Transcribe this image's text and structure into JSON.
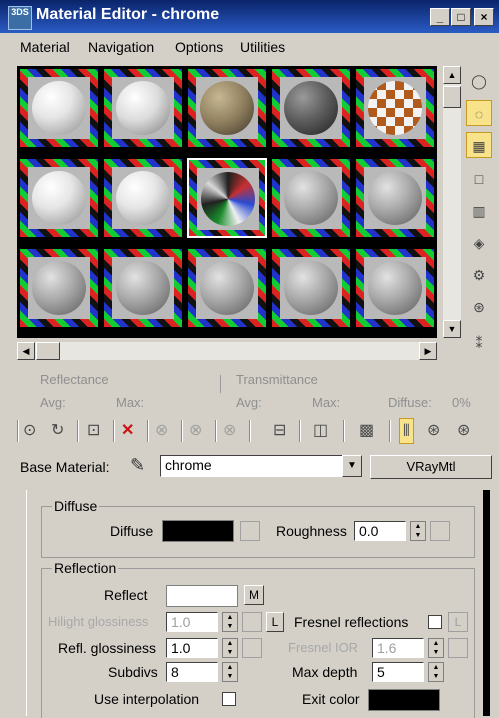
{
  "window": {
    "app_icon_text": "3DS",
    "title": "Material Editor - chrome",
    "min_label": "_",
    "max_label": "□",
    "close_label": "×"
  },
  "menu": [
    "Material",
    "Navigation",
    "Options",
    "Utilities"
  ],
  "slot_types": [
    [
      "white-matte",
      "white-textured",
      "stone",
      "dark-gray",
      "checker"
    ],
    [
      "white-matte",
      "white-matte",
      "chrome-selected",
      "gray",
      "gray"
    ],
    [
      "gray",
      "gray",
      "gray",
      "gray",
      "gray"
    ]
  ],
  "side_tools": [
    "sample-type-sphere-icon",
    "backlight-icon",
    "background-checker-icon",
    "sample-uv-tiling-icon",
    "video-color-check-icon",
    "make-preview-icon",
    "options-icon",
    "select-by-material-icon",
    "material-map-navigator-icon"
  ],
  "status": {
    "reflectance_label": "Reflectance",
    "transmittance_label": "Transmittance",
    "avg_label": "Avg:",
    "max_label": "Max:",
    "diffuse_label": "Diffuse:",
    "diffuse_value": "0%"
  },
  "base_material": {
    "label": "Base Material:",
    "name": "chrome",
    "type_button": "VRayMtl"
  },
  "diffuse_group": {
    "title": "Diffuse",
    "diffuse_label": "Diffuse",
    "diffuse_color": "#000000",
    "roughness_label": "Roughness",
    "roughness_value": "0.0"
  },
  "reflection_group": {
    "title": "Reflection",
    "reflect_label": "Reflect",
    "reflect_color": "#ffffff",
    "m_button": "M",
    "hilight_label": "Hilight glossiness",
    "hilight_value": "1.0",
    "l_button": "L",
    "fresnel_label": "Fresnel reflections",
    "refl_gloss_label": "Refl. glossiness",
    "refl_gloss_value": "1.0",
    "fresnel_ior_label": "Fresnel IOR",
    "fresnel_ior_value": "1.6",
    "subdivs_label": "Subdivs",
    "subdivs_value": "8",
    "max_depth_label": "Max depth",
    "max_depth_value": "5",
    "use_interp_label": "Use interpolation",
    "exit_color_label": "Exit color",
    "exit_color": "#000000"
  }
}
